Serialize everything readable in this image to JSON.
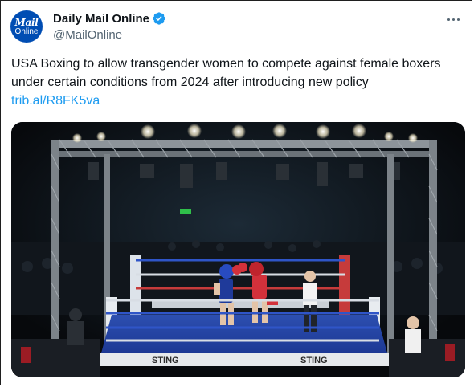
{
  "account": {
    "display_name": "Daily Mail Online",
    "handle": "@MailOnline",
    "avatar_line1": "Mail",
    "avatar_line2": "Online",
    "verified_color": "#1d9bf0"
  },
  "tweet": {
    "text": "USA Boxing to allow transgender women to compete against female boxers under certain conditions from 2024 after introducing new policy",
    "link": "trib.al/R8FK5va"
  },
  "media": {
    "sponsor": "STING",
    "icon": "boxing-ring-photo"
  },
  "icons": {
    "more": "more-options-icon",
    "verified": "verified-badge-icon"
  }
}
